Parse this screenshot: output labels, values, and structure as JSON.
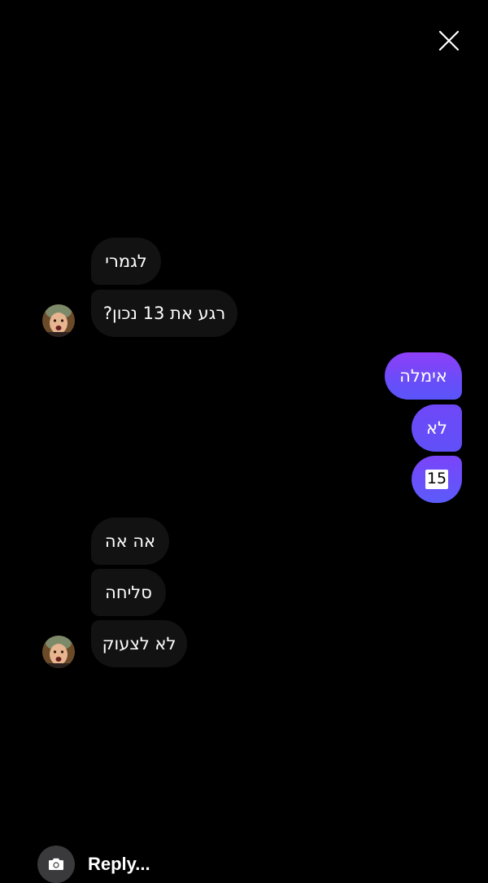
{
  "header": {
    "close_icon": "close-icon"
  },
  "thread": {
    "incoming_group_1": [
      "לגמרי",
      "רגע את 13 נכון?"
    ],
    "outgoing_group": [
      "אימלה",
      "לא",
      "15"
    ],
    "incoming_group_2": [
      "אה אה",
      "סליחה",
      "לא לצעוק"
    ]
  },
  "composer": {
    "camera_icon": "camera-icon",
    "placeholder": "Reply..."
  },
  "colors": {
    "background": "#000000",
    "incoming_bubble": "#121212",
    "outgoing_gradient_top": "#8f3ff8",
    "outgoing_gradient_bottom": "#5a55f8"
  }
}
